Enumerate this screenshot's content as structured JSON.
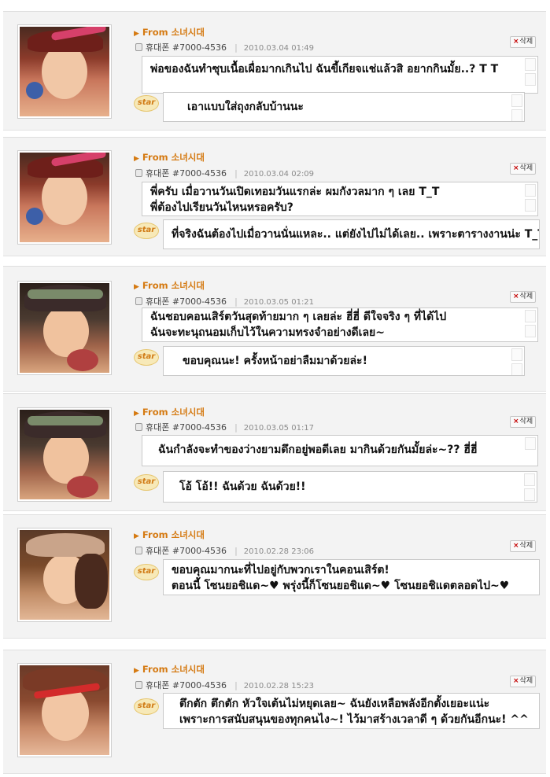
{
  "posts": [
    {
      "from_label": "From",
      "author": "소녀시대",
      "phone_label": "휴대폰",
      "phone_number": "#7000-4536",
      "timestamp": "2010.03.04 01:49",
      "delete_label": "삭제",
      "fan_lines": [
        "พ่อของฉันทำซุบเนื้อเผื่อมากเกินไป ฉันขี้เกียจแช่แล้วสิ อยากกินมั้ย..? T T"
      ],
      "star_label": "star",
      "reply_lines": [
        "เอาแบบใส่ถุงกลับบ้านนะ"
      ]
    },
    {
      "from_label": "From",
      "author": "소녀시대",
      "phone_label": "휴대폰",
      "phone_number": "#7000-4536",
      "timestamp": "2010.03.04 02:09",
      "delete_label": "삭제",
      "fan_lines": [
        "พี่ครับ เมื่อวานวันเปิดเทอมวันแรกล่ะ ผมกังวลมาก ๆ เลย T_T",
        "พี่ต้องไปเรียนวันไหนหรอครับ?"
      ],
      "star_label": "star",
      "reply_lines": [
        "ที่จริงฉันต้องไปเมื่อวานนั่นแหละ.. แต่ยังไปไม่ได้เลย.. เพราะตารางงานน่ะ T_T"
      ]
    },
    {
      "from_label": "From",
      "author": "소녀시대",
      "phone_label": "휴대폰",
      "phone_number": "#7000-4536",
      "timestamp": "2010.03.05 01:21",
      "delete_label": "삭제",
      "fan_lines": [
        "ฉันชอบคอนเสิร์ตวันสุดท้ายมาก ๆ เลยล่ะ ฮี่ฮี่ ดีใจจริง ๆ ที่ได้ไป",
        "ฉันจะทะนุถนอมเก็บไว้ในความทรงจำอย่างดีเลย~"
      ],
      "star_label": "star",
      "reply_lines": [
        "ขอบคุณนะ! ครั้งหน้าอย่าลืมมาด้วยล่ะ!"
      ]
    },
    {
      "from_label": "From",
      "author": "소녀시대",
      "phone_label": "휴대폰",
      "phone_number": "#7000-4536",
      "timestamp": "2010.03.05 01:17",
      "delete_label": "삭제",
      "fan_lines": [
        "ฉันกำลังจะทำของว่างยามดึกอยู่พอดีเลย มากินด้วยกันมั้ยล่ะ~?? ฮี่ฮี่"
      ],
      "star_label": "star",
      "reply_lines": [
        "โอ้ โอ้!! ฉันด้วย ฉันด้วย!!"
      ]
    },
    {
      "from_label": "From",
      "author": "소녀시대",
      "phone_label": "휴대폰",
      "phone_number": "#7000-4536",
      "timestamp": "2010.02.28 23:06",
      "delete_label": "삭제",
      "fan_lines": [],
      "star_label": "star",
      "reply_lines": [
        "ขอบคุณมากนะที่ไปอยู่กับพวกเราในคอนเสิร์ต!",
        "ตอนนี้ โซนยอชิแด~♥ พรุ่งนี้ก็โซนยอชิแด~♥ โซนยอชิแดตลอดไป~♥"
      ]
    },
    {
      "from_label": "From",
      "author": "소녀시대",
      "phone_label": "휴대폰",
      "phone_number": "#7000-4536",
      "timestamp": "2010.02.28 15:23",
      "delete_label": "삭제",
      "fan_lines": [],
      "star_label": "star",
      "reply_lines": [
        "ตึกตัก ตึกตัก หัวใจเต้นไม่หยุดเลย~ ฉันยังเหลือพลังอีกตั้งเยอะแน่ะ",
        "เพราะการสนับสนุนของทุกคนไง~! ไว้มาสร้างเวลาดี ๆ ด้วยกันอีกนะ! ^^"
      ]
    }
  ]
}
